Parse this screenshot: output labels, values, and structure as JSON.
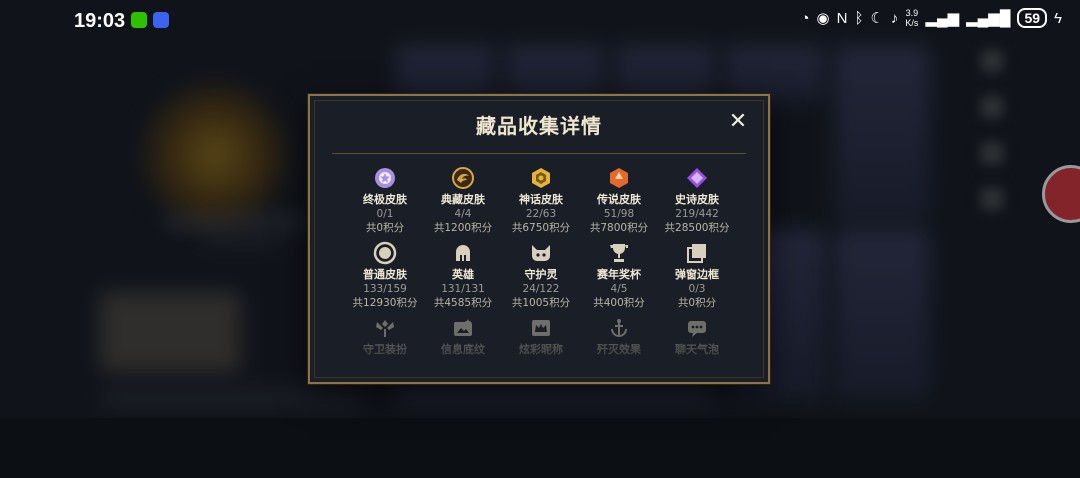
{
  "status_bar": {
    "time": "19:03",
    "net_speed_value": "3.9",
    "net_speed_unit": "K/s",
    "battery": "59"
  },
  "modal": {
    "title": "藏品收集详情",
    "close_symbol": "✕",
    "rows": [
      [
        {
          "icon": "ultimate-skin-icon",
          "name": "终极皮肤",
          "count": "0/1",
          "points": "共0积分",
          "color": "#a98fe0"
        },
        {
          "icon": "collector-skin-icon",
          "name": "典藏皮肤",
          "count": "4/4",
          "points": "共1200积分",
          "color": "#d9a54a"
        },
        {
          "icon": "mythic-skin-icon",
          "name": "神话皮肤",
          "count": "22/63",
          "points": "共6750积分",
          "color": "#e5b33a"
        },
        {
          "icon": "legendary-skin-icon",
          "name": "传说皮肤",
          "count": "51/98",
          "points": "共7800积分",
          "color": "#e26a2c"
        },
        {
          "icon": "epic-skin-icon",
          "name": "史诗皮肤",
          "count": "219/442",
          "points": "共28500积分",
          "color": "#9b4fe0"
        }
      ],
      [
        {
          "icon": "common-skin-icon",
          "name": "普通皮肤",
          "count": "133/159",
          "points": "共12930积分",
          "color": "#d8d0bc"
        },
        {
          "icon": "hero-helmet-icon",
          "name": "英雄",
          "count": "131/131",
          "points": "共4585积分",
          "color": "#d8d0bc"
        },
        {
          "icon": "guardian-icon",
          "name": "守护灵",
          "count": "24/122",
          "points": "共1005积分",
          "color": "#d8d0bc"
        },
        {
          "icon": "trophy-icon",
          "name": "赛年奖杯",
          "count": "4/5",
          "points": "共400积分",
          "color": "#d8d0bc"
        },
        {
          "icon": "frame-icon",
          "name": "弹窗边框",
          "count": "0/3",
          "points": "共0积分",
          "color": "#d8d0bc"
        }
      ],
      [
        {
          "icon": "ward-icon",
          "name": "守卫装扮",
          "color": "#d8d0bc"
        },
        {
          "icon": "emblem-icon",
          "name": "信息底纹",
          "color": "#d8d0bc"
        },
        {
          "icon": "crown-icon",
          "name": "炫彩昵称",
          "color": "#d8d0bc"
        },
        {
          "icon": "anchor-icon",
          "name": "歼灭效果",
          "color": "#d8d0bc"
        },
        {
          "icon": "chat-bubble-icon",
          "name": "聊天气泡",
          "color": "#d8d0bc"
        }
      ]
    ]
  }
}
